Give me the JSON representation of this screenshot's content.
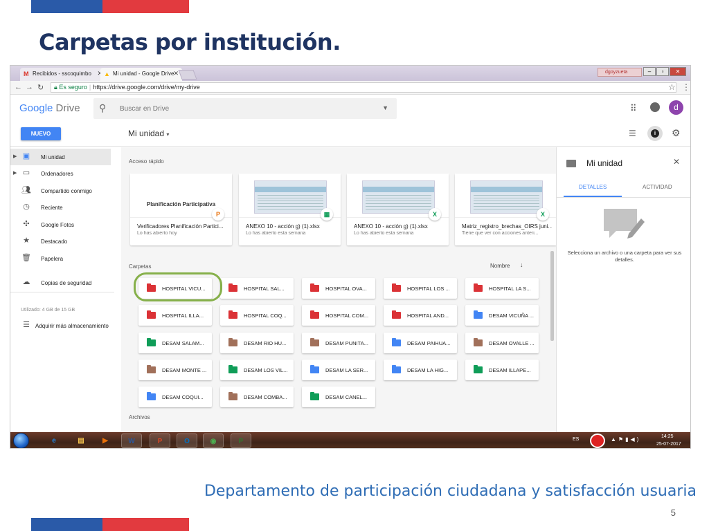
{
  "slide": {
    "title": "Carpetas por institución.",
    "footer": "Departamento de participación ciudadana y satisfacción usuaria",
    "page_number": "5"
  },
  "browser": {
    "tabs": [
      {
        "label": "Recibidos - sscoquimbo",
        "icon": "gmail-icon",
        "active": false
      },
      {
        "label": "Mi unidad - Google Drive",
        "icon": "drive-icon",
        "active": true
      }
    ],
    "user_chip": "dgoyzueta",
    "secure_label": "Es seguro",
    "url": "https://drive.google.com/drive/my-drive"
  },
  "drive": {
    "logo_google": "Google",
    "logo_drive": "Drive",
    "search_placeholder": "Buscar en Drive",
    "avatar_letter": "d",
    "new_button": "NUEVO",
    "location_title": "Mi unidad"
  },
  "sidebar": {
    "items": [
      {
        "label": "Mi unidad",
        "icon": "drive-icon",
        "active": true,
        "expandable": true
      },
      {
        "label": "Ordenadores",
        "icon": "computer-icon",
        "active": false,
        "expandable": true
      },
      {
        "label": "Compartido conmigo",
        "icon": "people-icon",
        "active": false,
        "expandable": false
      },
      {
        "label": "Reciente",
        "icon": "clock-icon",
        "active": false,
        "expandable": false
      },
      {
        "label": "Google Fotos",
        "icon": "pinwheel-icon",
        "active": false,
        "expandable": false
      },
      {
        "label": "Destacado",
        "icon": "star-icon",
        "active": false,
        "expandable": false
      },
      {
        "label": "Papelera",
        "icon": "trash-icon",
        "active": false,
        "expandable": false
      },
      {
        "label": "Copias de seguridad",
        "icon": "cloud-icon",
        "active": false,
        "expandable": false
      }
    ],
    "storage_used": "Utilizado: 4 GB de 15 GB",
    "buy_storage": "Adquirir más almacenamiento"
  },
  "quick_access": {
    "heading": "Acceso rápido",
    "cards": [
      {
        "name": "Verificadores Planificación Partici...",
        "sub": "Lo has abierto hoy",
        "thumb_title": "Planificación Participativa",
        "badge": "P",
        "badge_color": "#e8710a",
        "kind": "slides"
      },
      {
        "name": "ANEXO 10 - acción g) (1).xlsx",
        "sub": "Lo has abierto esta semana",
        "thumb_title": "",
        "badge": "▦",
        "badge_color": "#0f9d58",
        "kind": "sheet"
      },
      {
        "name": "ANEXO 10 - acción g) (1).xlsx",
        "sub": "Lo has abierto esta semana",
        "thumb_title": "",
        "badge": "X",
        "badge_color": "#0f9d58",
        "kind": "sheet"
      },
      {
        "name": "Matriz_registro_brechas_OIRS juni...",
        "sub": "Tiene que ver con acciones anteri...",
        "thumb_title": "",
        "badge": "X",
        "badge_color": "#0f9d58",
        "kind": "sheet"
      }
    ]
  },
  "folders": {
    "heading": "Carpetas",
    "sort_label": "Nombre",
    "items": [
      {
        "name": "HOSPITAL VICU...",
        "color": "#db3236"
      },
      {
        "name": "HOSPITAL SAL...",
        "color": "#db3236"
      },
      {
        "name": "HOSPITAL OVA...",
        "color": "#db3236"
      },
      {
        "name": "HOSPITAL LOS ...",
        "color": "#db3236"
      },
      {
        "name": "HOSPITAL LA S...",
        "color": "#db3236"
      },
      {
        "name": "HOSPITAL ILLA...",
        "color": "#db3236"
      },
      {
        "name": "HOSPITAL COQ...",
        "color": "#db3236"
      },
      {
        "name": "HOSPITAL COM...",
        "color": "#db3236"
      },
      {
        "name": "HOSPITAL AND...",
        "color": "#db3236"
      },
      {
        "name": "DESAM VICUÑA ...",
        "color": "#4285f4"
      },
      {
        "name": "DESAM SALAM...",
        "color": "#0f9d58"
      },
      {
        "name": "DESAM RIO HU...",
        "color": "#a1705a"
      },
      {
        "name": "DESAM PUNITA...",
        "color": "#a1705a"
      },
      {
        "name": "DESAM PAIHUA...",
        "color": "#4285f4"
      },
      {
        "name": "DESAM OVALLE ...",
        "color": "#a1705a"
      },
      {
        "name": "DESAM MONTE ...",
        "color": "#a1705a"
      },
      {
        "name": "DESAM LOS VIL...",
        "color": "#0f9d58"
      },
      {
        "name": "DESAM LA SER...",
        "color": "#4285f4"
      },
      {
        "name": "DESAM LA HIG...",
        "color": "#4285f4"
      },
      {
        "name": "DESAM ILLAPE...",
        "color": "#0f9d58"
      },
      {
        "name": "DESAM COQUI...",
        "color": "#4285f4"
      },
      {
        "name": "DESAM COMBA...",
        "color": "#a1705a"
      },
      {
        "name": "DESAM CANEL...",
        "color": "#0f9d58"
      }
    ],
    "files_heading": "Archivos"
  },
  "details_panel": {
    "title": "Mi unidad",
    "tab_details": "DETALLES",
    "tab_activity": "ACTIVIDAD",
    "empty_text": "Selecciona un archivo o una carpeta para ver sus detalles."
  },
  "taskbar": {
    "apps": [
      {
        "icon": "ie-icon",
        "glyph": "e",
        "color": "#1e88e5"
      },
      {
        "icon": "explorer-icon",
        "glyph": "▤",
        "color": "#f2c14e"
      },
      {
        "icon": "media-player-icon",
        "glyph": "▶",
        "color": "#e8710a"
      },
      {
        "icon": "word-icon",
        "glyph": "W",
        "color": "#2b579a"
      },
      {
        "icon": "powerpoint-icon",
        "glyph": "P",
        "color": "#d24726"
      },
      {
        "icon": "outlook-icon",
        "glyph": "O",
        "color": "#0072c6"
      },
      {
        "icon": "chrome-icon",
        "glyph": "◉",
        "color": "#4caf50"
      },
      {
        "icon": "project-icon",
        "glyph": "P",
        "color": "#31752f"
      }
    ],
    "lang": "ES",
    "time": "14:25",
    "date": "25-07-2017"
  }
}
